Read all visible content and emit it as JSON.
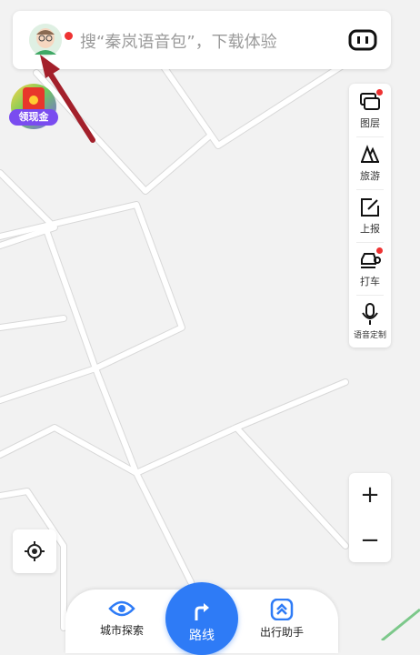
{
  "search": {
    "placeholder": "搜“秦岚语音包”，下载体验",
    "avatar_icon": "user-avatar-icon",
    "voice_icon": "voice-robot-icon"
  },
  "promo": {
    "label": "领现金",
    "icon": "red-envelope-icon"
  },
  "toolbar": {
    "items": [
      {
        "label": "图层",
        "icon": "layers-icon",
        "badge": true
      },
      {
        "label": "旅游",
        "icon": "travel-icon",
        "badge": false
      },
      {
        "label": "上报",
        "icon": "report-icon",
        "badge": false
      },
      {
        "label": "打车",
        "icon": "taxi-icon",
        "badge": true
      },
      {
        "label": "语音定制",
        "icon": "microphone-icon",
        "badge": false
      }
    ]
  },
  "zoom": {
    "in_label": "+",
    "out_label": "−"
  },
  "locate": {
    "icon": "locate-icon"
  },
  "bottom_nav": {
    "left": {
      "label": "城市探索",
      "icon": "eye-icon"
    },
    "center": {
      "label": "路线",
      "icon": "route-arrow-icon"
    },
    "right": {
      "label": "出行助手",
      "icon": "assistant-icon"
    }
  },
  "colors": {
    "accent": "#2e7bf6",
    "badge": "#e33333",
    "annotation_arrow": "#a3202b",
    "map_background": "#f2f2f2",
    "road": "#ffffff"
  }
}
